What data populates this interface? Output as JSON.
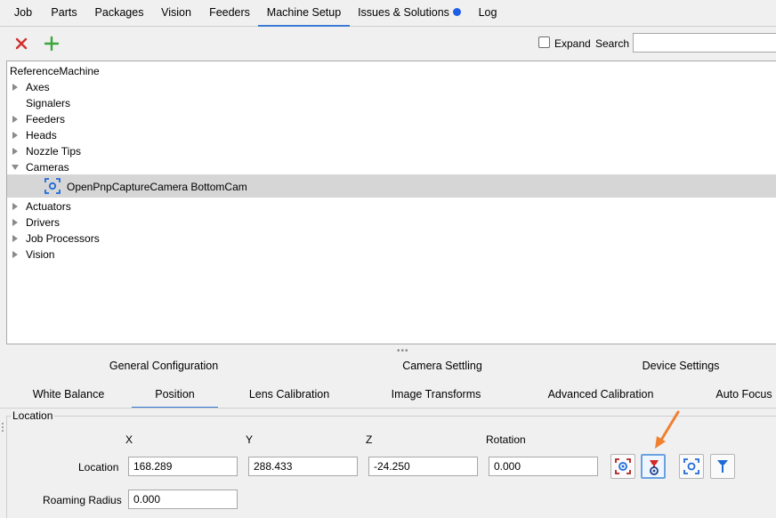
{
  "tabs": [
    "Job",
    "Parts",
    "Packages",
    "Vision",
    "Feeders",
    "Machine Setup",
    "Issues & Solutions",
    "Log"
  ],
  "active_tab": "Machine Setup",
  "toolbar": {
    "expand_label": "Expand",
    "search_label": "Search",
    "search_value": ""
  },
  "tree": {
    "root": "ReferenceMachine",
    "items": [
      "Axes",
      "Signalers",
      "Feeders",
      "Heads",
      "Nozzle Tips",
      "Cameras",
      "Actuators",
      "Drivers",
      "Job Processors",
      "Vision"
    ],
    "selected_child": "OpenPnpCaptureCamera BottomCam"
  },
  "subtabs_row1": [
    "General Configuration",
    "Camera Settling",
    "Device Settings"
  ],
  "subtabs_row2": [
    "White Balance",
    "Position",
    "Lens Calibration",
    "Image Transforms",
    "Advanced Calibration",
    "Auto Focus"
  ],
  "active_subtab": "Position",
  "location": {
    "group_title": "Location",
    "headers": [
      "X",
      "Y",
      "Z",
      "Rotation"
    ],
    "row_label": "Location",
    "values": [
      "168.289",
      "288.433",
      "-24.250",
      "0.000"
    ],
    "roaming_label": "Roaming Radius",
    "roaming_value": "0.000"
  },
  "colors": {
    "accent": "#3a7bd5",
    "delete": "#d32f2f",
    "add": "#3aa63a",
    "annotation_arrow": "#f07f2f"
  }
}
